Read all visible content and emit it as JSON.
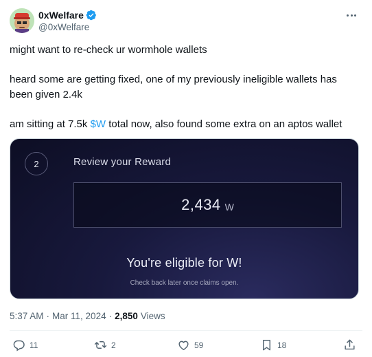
{
  "author": {
    "display_name": "0xWelfare",
    "handle": "@0xWelfare",
    "verified": true
  },
  "more_icon": "more-horizontal-icon",
  "tweet": {
    "line1": "might want to re-check ur wormhole wallets",
    "line2": "heard some are getting fixed, one of my previously ineligible wallets has been given 2.4k",
    "line3_before": "am sitting at 7.5k ",
    "line3_cashtag": "$W",
    "line3_after": " total now, also found some extra on an aptos wallet"
  },
  "media": {
    "step_number": "2",
    "title": "Review your Reward",
    "amount": "2,434",
    "unit": "W",
    "eligible_text": "You're eligible for W!",
    "sub_text": "Check back later once claims open."
  },
  "meta": {
    "time": "5:37 AM",
    "separator": "·",
    "date": "Mar 11, 2024",
    "separator2": "·",
    "views_count": "2,850",
    "views_label": "Views"
  },
  "actions": {
    "replies": "11",
    "reposts": "2",
    "likes": "59",
    "bookmarks": "18"
  },
  "colors": {
    "accent": "#1d9bf0",
    "text_primary": "#0f1419",
    "text_secondary": "#536471"
  }
}
